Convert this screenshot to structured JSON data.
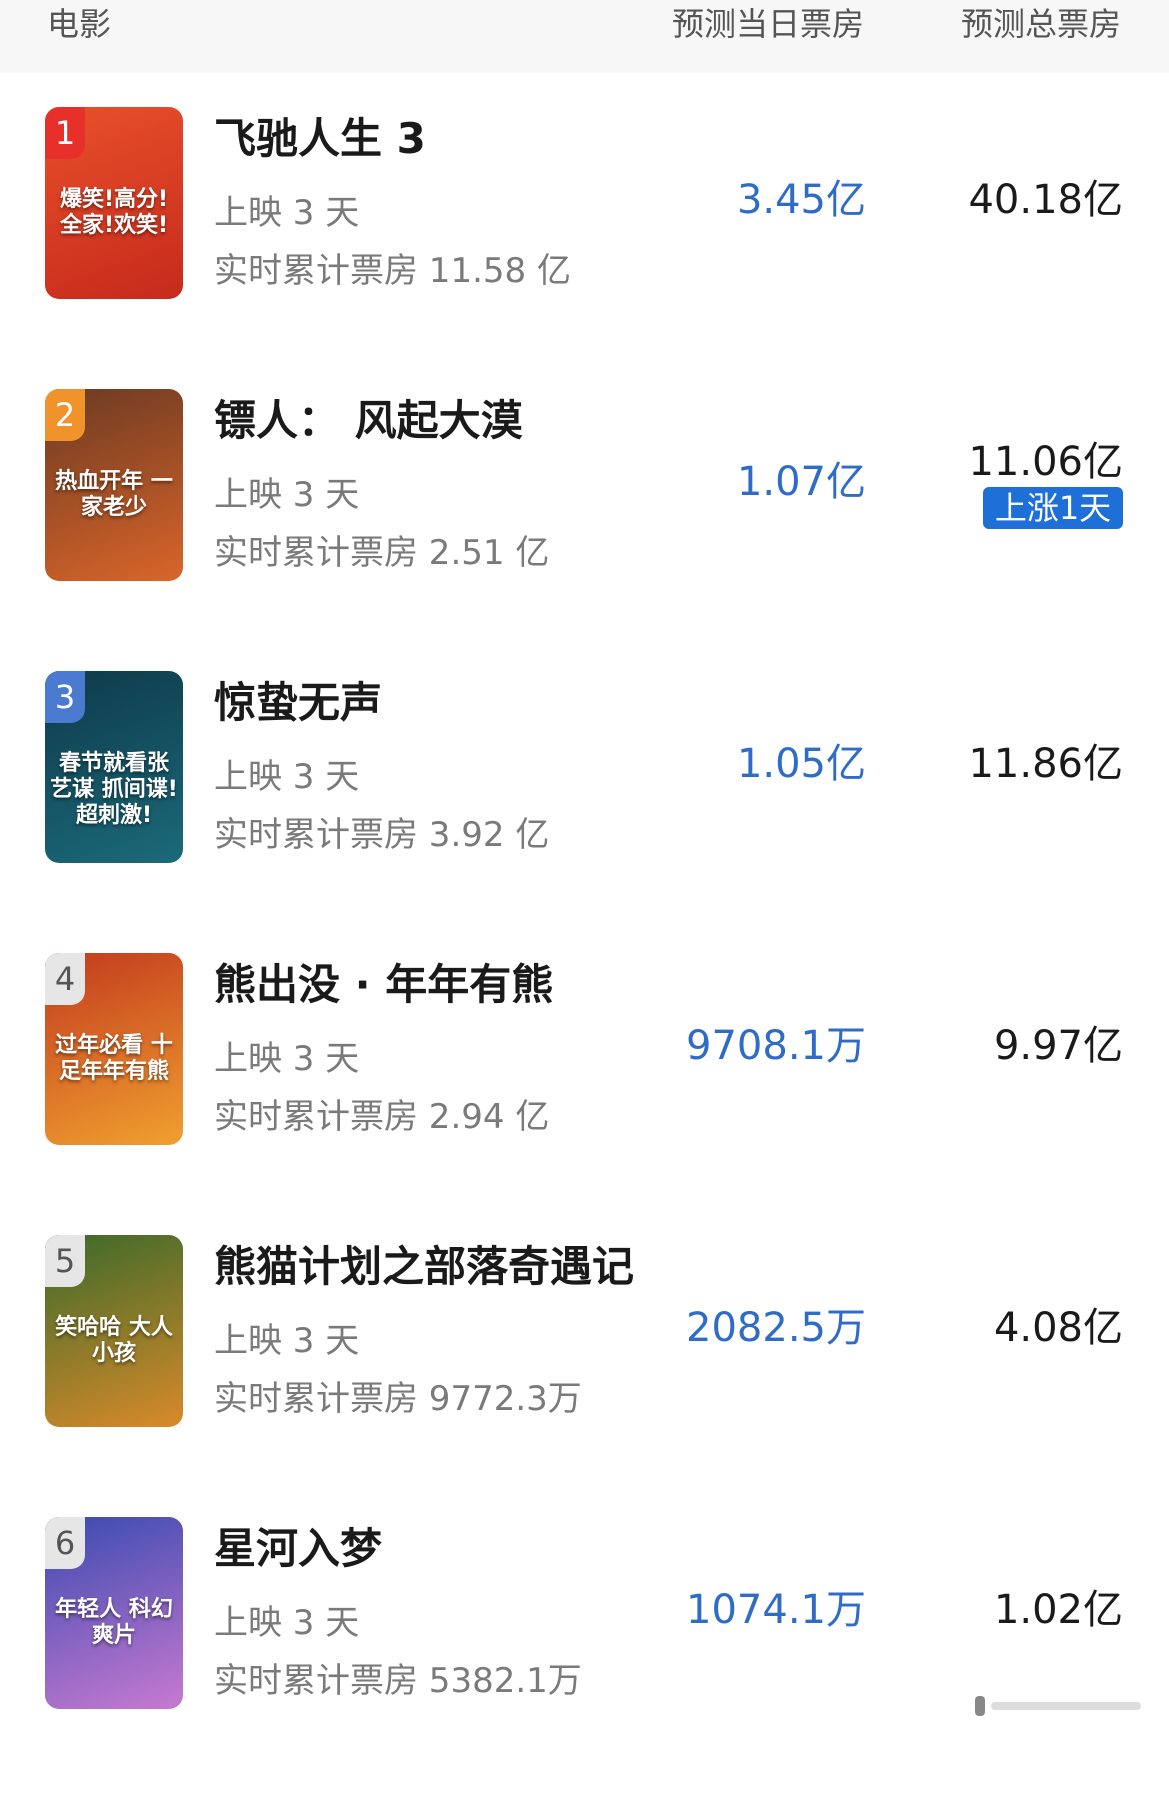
{
  "header": {
    "movie_label": "电影",
    "day_label": "预测当日票房",
    "total_label": "预测总票房"
  },
  "movies": [
    {
      "rank": "1",
      "title": "飞驰人生 3",
      "days": "上映 3 天",
      "cumulative": "实时累计票房 11.58 亿",
      "predicted_day": "3.45亿",
      "predicted_total": "40.18亿",
      "poster_text": "爆笑!高分!全家!欢笑!",
      "rank_color": "#e8302a",
      "poster_colors": [
        "#e8502a",
        "#c62a1c"
      ]
    },
    {
      "rank": "2",
      "title": "镖人：  风起大漠",
      "days": "上映 3 天",
      "cumulative": "实时累计票房 2.51 亿",
      "predicted_day": "1.07亿",
      "predicted_total": "11.06亿",
      "badge": "上涨1天",
      "poster_text": "热血开年 一家老少",
      "rank_color": "#f0932a",
      "poster_colors": [
        "#6b3a22",
        "#d9652a"
      ]
    },
    {
      "rank": "3",
      "title": "惊蛰无声",
      "days": "上映 3 天",
      "cumulative": "实时累计票房 3.92 亿",
      "predicted_day": "1.05亿",
      "predicted_total": "11.86亿",
      "poster_text": "春节就看张艺谋 抓间谍!超刺激!",
      "rank_color": "#4a7bd0",
      "poster_colors": [
        "#0e3a4a",
        "#1b6a7a"
      ]
    },
    {
      "rank": "4",
      "title": "熊出没 · 年年有熊",
      "days": "上映 3 天",
      "cumulative": "实时累计票房 2.94 亿",
      "predicted_day": "9708.1万",
      "predicted_total": "9.97亿",
      "poster_text": "过年必看 十足年年有熊",
      "rank_color": "#e6e6e6",
      "poster_colors": [
        "#c23a1e",
        "#f0a030"
      ]
    },
    {
      "rank": "5",
      "title": "熊猫计划之部落奇遇记",
      "days": "上映 3 天",
      "cumulative": "实时累计票房 9772.3万",
      "predicted_day": "2082.5万",
      "predicted_total": "4.08亿",
      "poster_text": "笑哈哈 大人小孩",
      "rank_color": "#e6e6e6",
      "poster_colors": [
        "#3a6a2a",
        "#d98a2a"
      ]
    },
    {
      "rank": "6",
      "title": "星河入梦",
      "days": "上映 3 天",
      "cumulative": "实时累计票房 5382.1万",
      "predicted_day": "1074.1万",
      "predicted_total": "1.02亿",
      "poster_text": "年轻人 科幻爽片",
      "rank_color": "#e6e6e6",
      "poster_colors": [
        "#3a4ab0",
        "#c77ad0"
      ]
    }
  ]
}
